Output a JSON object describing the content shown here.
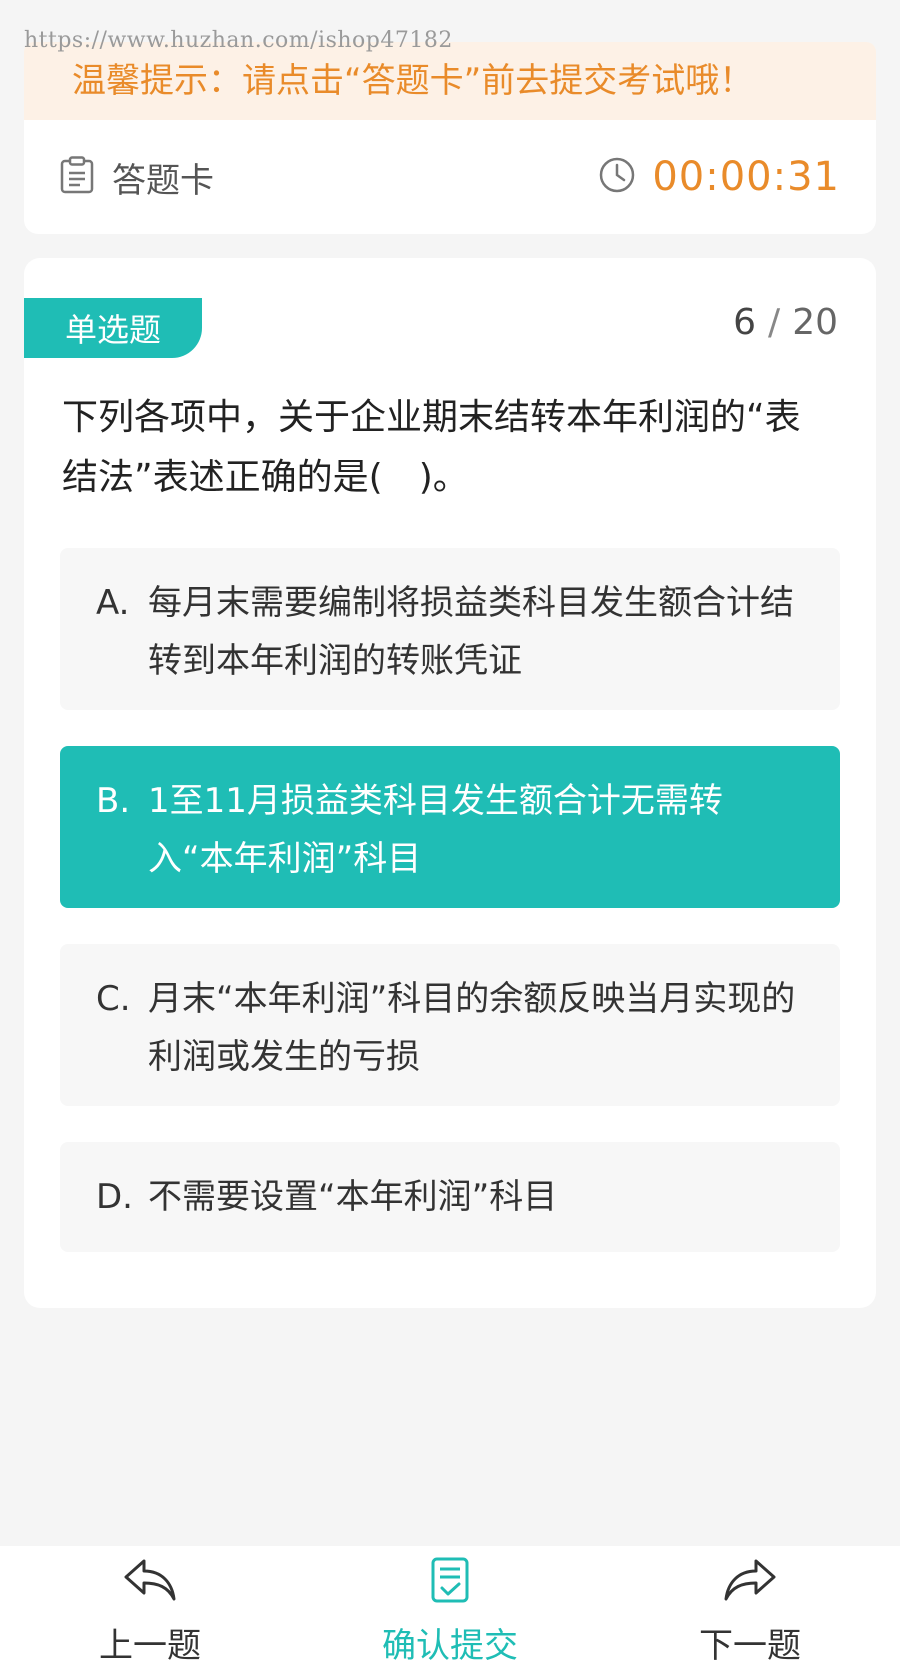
{
  "watermark": "https://www.huzhan.com/ishop47182",
  "tip": "温馨提示：请点击“答题卡”前去提交考试哦！",
  "header": {
    "answer_card_label": "答题卡",
    "timer": "00:00:31"
  },
  "question": {
    "type": "单选题",
    "current": "6",
    "separator": "/",
    "total": "20",
    "text": "下列各项中，关于企业期末结转本年利润的“表结法”表述正确的是(　)。",
    "options": [
      {
        "letter": "A.",
        "text": "每月末需要编制将损益类科目发生额合计结转到本年利润的转账凭证"
      },
      {
        "letter": "B.",
        "text": "1至11月损益类科目发生额合计无需转入“本年利润”科目"
      },
      {
        "letter": "C.",
        "text": "月末“本年利润”科目的余额反映当月实现的利润或发生的亏损"
      },
      {
        "letter": "D.",
        "text": "不需要设置“本年利润”科目"
      }
    ],
    "selected": "B"
  },
  "bottom_nav": {
    "prev_label": "上一题",
    "submit_label": "确认提交",
    "next_label": "下一题"
  },
  "colors": {
    "accent": "#1fbdb5",
    "warning": "#e98b2a",
    "tip_bg": "#fdf1e6"
  }
}
